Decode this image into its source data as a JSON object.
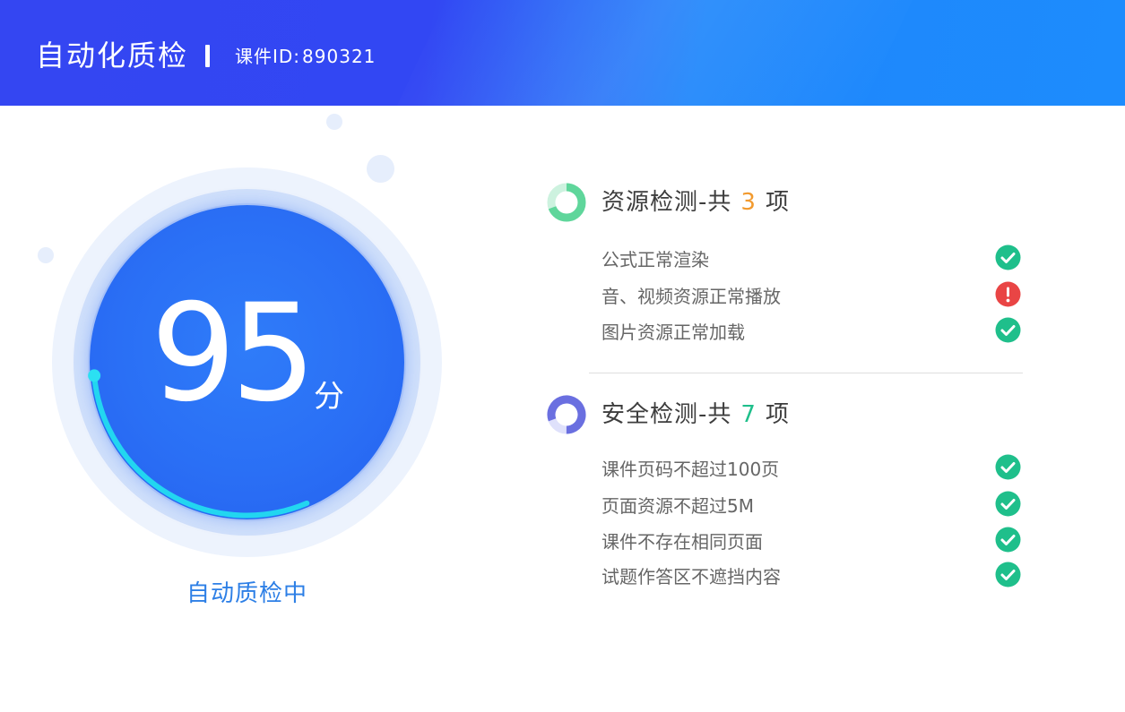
{
  "header": {
    "app_title": "自动化质检",
    "course_id_label": "课件ID:",
    "course_id_value": "890321"
  },
  "score": {
    "value": "95",
    "unit": "分",
    "status_text": "自动质检中",
    "progress_fraction": 0.3
  },
  "resource_check": {
    "title_prefix": "资源检测-共",
    "count": "3",
    "title_suffix": "项",
    "items": [
      {
        "label": "公式正常渲染",
        "status": "pass",
        "icon": "check-circle-icon"
      },
      {
        "label": "音、视频资源正常播放",
        "status": "error",
        "icon": "error-circle-icon"
      },
      {
        "label": "图片资源正常加载",
        "status": "pass",
        "icon": "check-circle-icon"
      }
    ]
  },
  "security_check": {
    "title_prefix": "安全检测-共",
    "count": "7",
    "title_suffix": "项",
    "items": [
      {
        "label": "课件页码不超过100页",
        "status": "pass",
        "icon": "check-circle-icon"
      },
      {
        "label": "页面资源不超过5M",
        "status": "pass",
        "icon": "check-circle-icon"
      },
      {
        "label": "课件不存在相同页面",
        "status": "pass",
        "icon": "check-circle-icon"
      },
      {
        "label": "试题作答区不遮挡内容",
        "status": "pass",
        "icon": "check-circle-icon"
      }
    ]
  },
  "colors": {
    "header_start": "#3446f2",
    "header_end": "#1d8cfd",
    "score_circle": "#2a6ff5",
    "progress_arc": "#22d6f0",
    "pass": "#1fbf8b",
    "error": "#e94545",
    "resource_count": "#f29a2e",
    "security_count": "#1fbf8b"
  }
}
